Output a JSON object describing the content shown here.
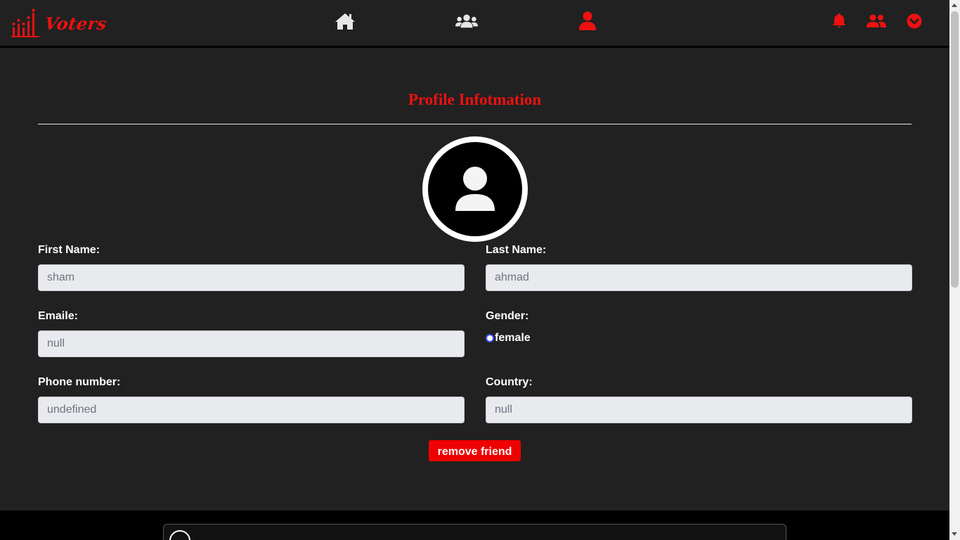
{
  "app": {
    "logo_text": "Voters",
    "accent": "#ee1111"
  },
  "nav": {
    "center_icons": [
      "home-icon",
      "groups-icon",
      "user-icon"
    ],
    "right_icons": [
      "bell-icon",
      "friends-icon",
      "chevron-down-circle-icon"
    ]
  },
  "profile": {
    "title": "Profile Infotmation",
    "fields": {
      "first_name": {
        "label": "First Name:",
        "placeholder": "sham"
      },
      "last_name": {
        "label": "Last Name:",
        "placeholder": "ahmad"
      },
      "email": {
        "label": "Emaile:",
        "placeholder": "null"
      },
      "gender": {
        "label": "Gender:",
        "value": "female"
      },
      "phone": {
        "label": "Phone number:",
        "placeholder": "undefined"
      },
      "country": {
        "label": "Country:",
        "placeholder": "null"
      }
    },
    "action_button": "remove friend"
  }
}
